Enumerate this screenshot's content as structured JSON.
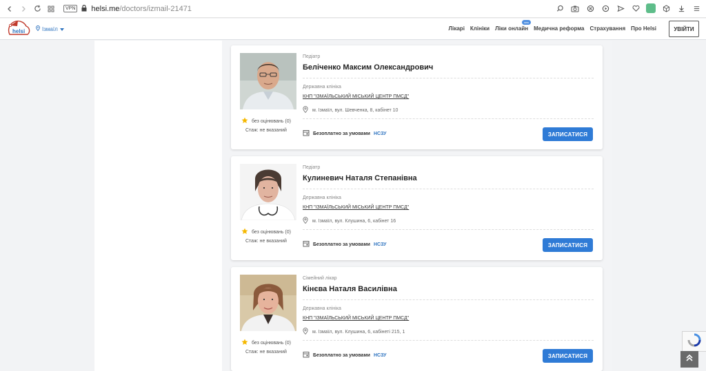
{
  "browser": {
    "url_host": "helsi.me",
    "url_path": "/doctors/izmail-21471",
    "vpn_label": "VPN"
  },
  "header": {
    "city": "Ізмаїл",
    "menu": [
      {
        "label": "Лікарі"
      },
      {
        "label": "Клініки"
      },
      {
        "label": "Ліки онлайн",
        "badge": "new"
      },
      {
        "label": "Медична реформа"
      },
      {
        "label": "Страхування"
      },
      {
        "label": "Про Helsi"
      }
    ],
    "login_label": "УВІЙТИ",
    "brand_color": "#2f74c0"
  },
  "doctors": [
    {
      "specialty": "Педіатр",
      "name": "Беліченко Максим Олександрович",
      "clinic_type": "Державна клініка",
      "clinic_name": "КНП \"ІЗМАЇЛЬСЬКИЙ МІСЬКИЙ ЦЕНТР ПМСД\"",
      "address": "м. Ізмаїл, вул. Шевченка, 8, кабінет 10",
      "rating": "без оцінювань (0)",
      "experience": "Стаж: не вказаний",
      "price_text": "Безоплатно за умовами",
      "price_program": "НСЗУ",
      "book_label": "ЗАПИСАТИСЯ"
    },
    {
      "specialty": "Педіатр",
      "name": "Кулиневич Наталя Степанівна",
      "clinic_type": "Державна клініка",
      "clinic_name": "КНП \"ІЗМАЇЛЬСЬКИЙ МІСЬКИЙ ЦЕНТР ПМСД\"",
      "address": "м. Ізмаїл, вул. Клушина, 6, кабінет 16",
      "rating": "без оцінювань (0)",
      "experience": "Стаж: не вказаний",
      "price_text": "Безоплатно за умовами",
      "price_program": "НСЗУ",
      "book_label": "ЗАПИСАТИСЯ"
    },
    {
      "specialty": "Сімейний лікар",
      "name": "Кінєва Наталя Василівна",
      "clinic_type": "Державна клініка",
      "clinic_name": "КНП \"ІЗМАЇЛЬСЬКИЙ МІСЬКИЙ ЦЕНТР ПМСД\"",
      "address": "м. Ізмаїл, вул. Клушина, 6, кабінеті 215, 1",
      "rating": "без оцінювань (0)",
      "experience": "Стаж: не вказаний",
      "price_text": "Безоплатно за умовами",
      "price_program": "НСЗУ",
      "book_label": "ЗАПИСАТИСЯ"
    }
  ]
}
